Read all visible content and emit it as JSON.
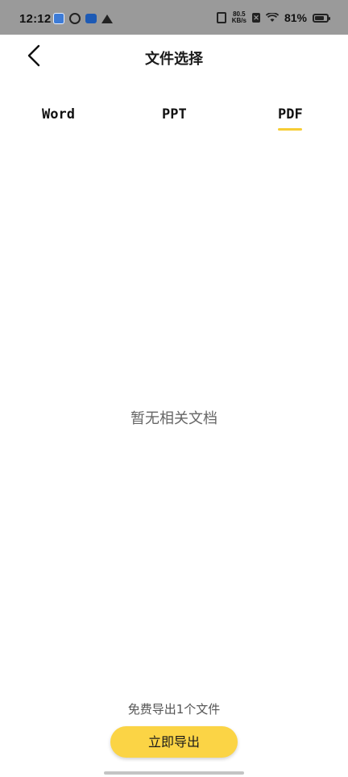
{
  "status_bar": {
    "time": "12:12",
    "net_speed_value": "80.5",
    "net_speed_unit": "KB/s",
    "battery_percent": "81%",
    "battery_level": 0.81,
    "left_icons": [
      "app-notification-icon",
      "link-icon",
      "app-notification-icon",
      "crown-icon"
    ],
    "right_icons": [
      "vibrate-icon",
      "close-box-icon",
      "wifi-icon",
      "battery-icon"
    ]
  },
  "nav": {
    "title": "文件选择",
    "back_icon": "chevron-left-icon"
  },
  "tabs": [
    {
      "label": "Word",
      "selected": false
    },
    {
      "label": "PPT",
      "selected": false
    },
    {
      "label": "PDF",
      "selected": true
    }
  ],
  "empty_state": {
    "message": "暂无相关文档"
  },
  "footer": {
    "free_note": "免费导出1个文件",
    "export_button_label": "立即导出"
  },
  "colors": {
    "accent": "#f7cd35",
    "button": "#fbd445",
    "status_bar_bg": "#9a9a9a",
    "muted_text": "#666666"
  }
}
